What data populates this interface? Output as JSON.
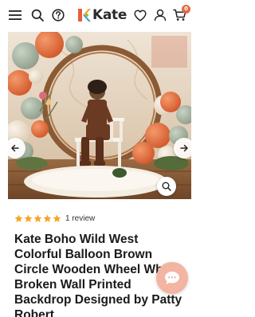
{
  "header": {
    "logo_text": "Kate",
    "cart_count": "0",
    "icons": [
      "menu-icon",
      "search-icon",
      "help-icon",
      "logo-icon",
      "heart-icon",
      "account-icon",
      "cart-icon"
    ]
  },
  "gallery": {
    "image_alt": "Kate Boho Wild West backdrop photo",
    "controls": [
      "prev-arrow-icon",
      "next-arrow-icon",
      "zoom-icon"
    ]
  },
  "product": {
    "rating": 5,
    "rating_max": 5,
    "review_text": "1 review",
    "title_lines": [
      "Kate Boho Wild West",
      "Colorful Balloon Brown",
      "Circle Wooden Wheel Whi",
      "Broken Wall Printed",
      "Backdrop Designed by Patty",
      "Robert"
    ]
  },
  "colors": {
    "accent": "#e06a44",
    "star": "#f5a623",
    "chat_bubble": "#f3b4a2"
  }
}
